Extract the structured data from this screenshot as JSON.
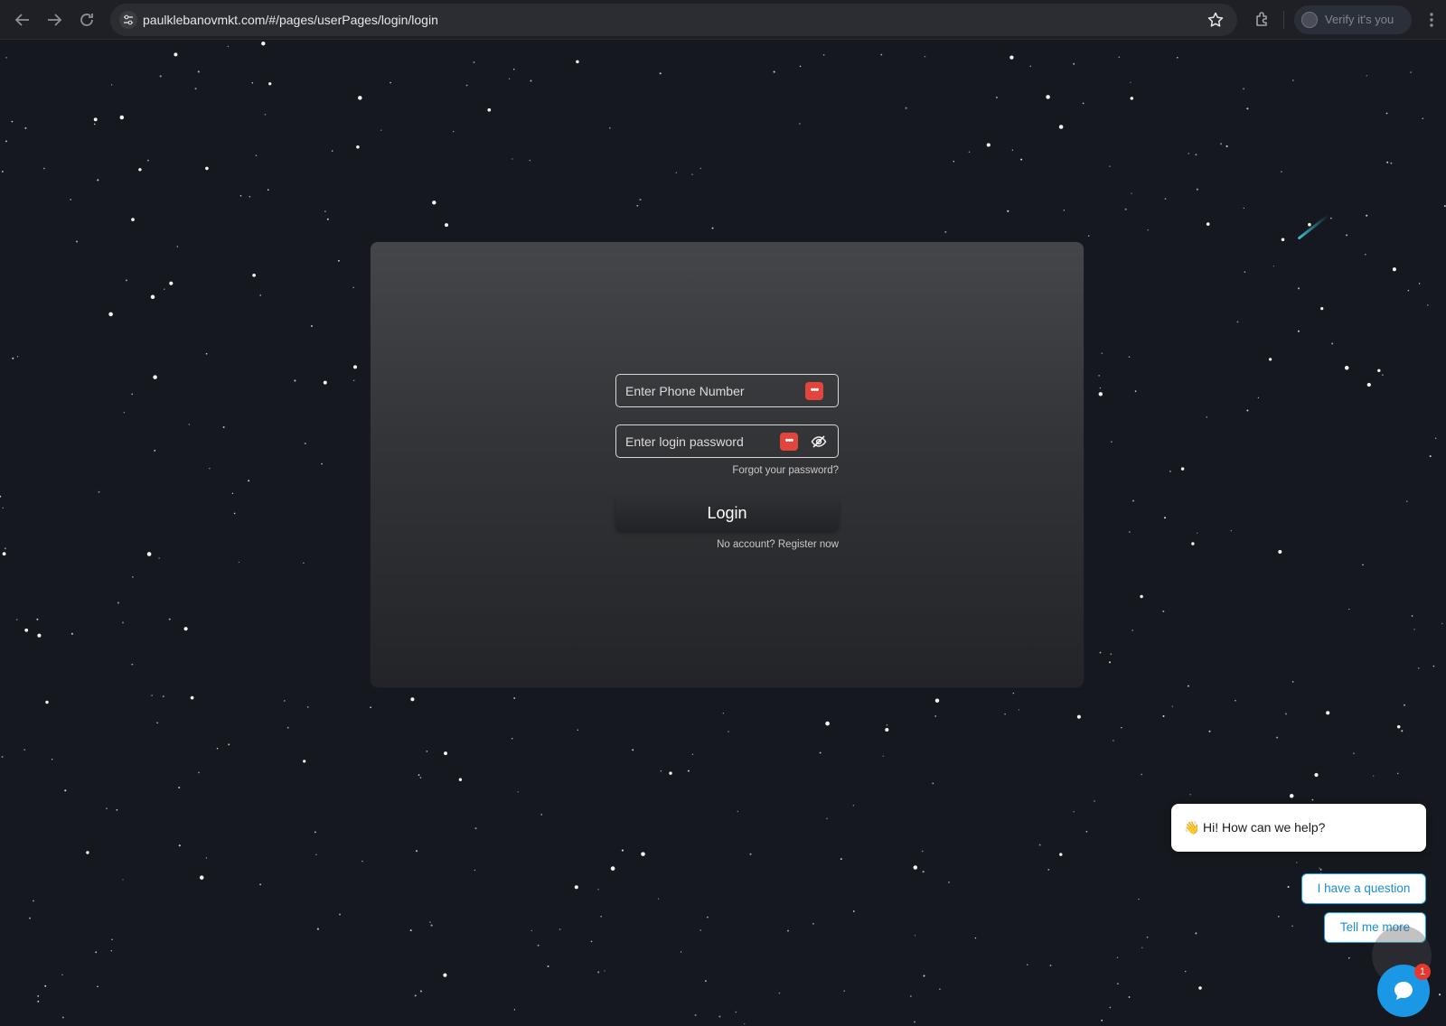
{
  "browser": {
    "url": "paulklebanovmkt.com/#/pages/userPages/login/login",
    "profile_label": "Verify it's you",
    "icons": {
      "back": "arrow-left-icon",
      "forward": "arrow-right-icon",
      "reload": "reload-icon",
      "site_settings": "tune-icon",
      "bookmark": "star-icon",
      "extensions": "puzzle-icon",
      "menu": "kebab-menu-icon"
    }
  },
  "login_form": {
    "phone_placeholder": "Enter Phone Number",
    "password_placeholder": "Enter login password",
    "forgot_link": "Forgot your password?",
    "login_button": "Login",
    "register_link": "No account? Register now",
    "password_manager_glyph": "•••",
    "icons": {
      "password_manager": "password-manager-icon",
      "toggle_visibility": "eye-off-icon"
    }
  },
  "chat_widget": {
    "wave_emoji": "👋",
    "greeting": "Hi! How can we help?",
    "options": [
      "I have a question",
      "Tell me more"
    ],
    "badge_count": "1",
    "accent_color": "#1a98e5"
  },
  "colors": {
    "background": "#15181e",
    "badge": "#e8372c",
    "password_manager": "#e2453b"
  }
}
